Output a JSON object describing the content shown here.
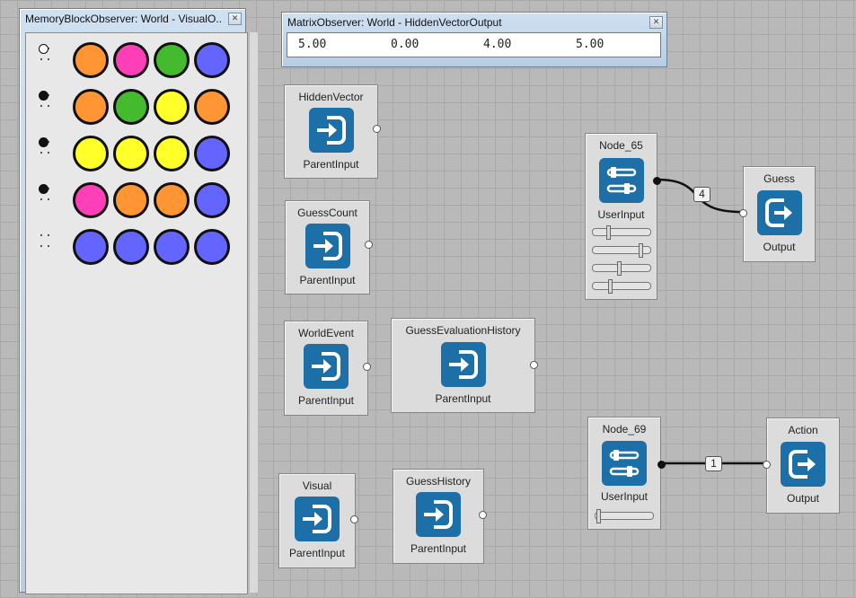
{
  "memory_observer": {
    "title": "MemoryBlockObserver: World - VisualO...",
    "rows": [
      {
        "indicator": "open",
        "pegs": [
          "#ff9633",
          "#ff3fb8",
          "#44bb2e",
          "#6464ff"
        ]
      },
      {
        "indicator": "filled",
        "pegs": [
          "#ff9633",
          "#44bb2e",
          "#ffff2a",
          "#ff9633"
        ]
      },
      {
        "indicator": "filled",
        "pegs": [
          "#ffff2a",
          "#ffff2a",
          "#ffff2a",
          "#6464ff"
        ]
      },
      {
        "indicator": "filled",
        "pegs": [
          "#ff3fb8",
          "#ff9633",
          "#ff9633",
          "#6464ff"
        ]
      },
      {
        "indicator": "none",
        "pegs": [
          "#6464ff",
          "#6464ff",
          "#6464ff",
          "#6464ff"
        ]
      }
    ]
  },
  "matrix_observer": {
    "title": "MatrixObserver: World - HiddenVectorOutput",
    "values": [
      "5.00",
      "0.00",
      "4.00",
      "5.00"
    ]
  },
  "nodes": {
    "hidden_vector": {
      "name": "HiddenVector",
      "type": "ParentInput"
    },
    "guess_count": {
      "name": "GuessCount",
      "type": "ParentInput"
    },
    "world_event": {
      "name": "WorldEvent",
      "type": "ParentInput"
    },
    "guess_eval": {
      "name": "GuessEvaluationHistory",
      "type": "ParentInput"
    },
    "visual": {
      "name": "Visual",
      "type": "ParentInput"
    },
    "guess_history": {
      "name": "GuessHistory",
      "type": "ParentInput"
    },
    "node_65": {
      "name": "Node_65",
      "type": "UserInput",
      "slider_levels": [
        0.25,
        0.85,
        0.45,
        0.28
      ]
    },
    "node_69": {
      "name": "Node_69",
      "type": "UserInput",
      "slider_levels": [
        0.02
      ]
    },
    "guess": {
      "name": "Guess",
      "type": "Output"
    },
    "action": {
      "name": "Action",
      "type": "Output"
    }
  },
  "edges": {
    "node65_to_guess": {
      "label": "4"
    },
    "node69_to_action": {
      "label": "1"
    }
  },
  "colors": {
    "icon_blue": "#1d6fa8",
    "orange": "#ff9633",
    "pink": "#ff3fb8",
    "green": "#44bb2e",
    "yellow": "#ffff2a",
    "blue": "#6464ff"
  },
  "icons": {
    "parent_input": "enter-arrow-icon",
    "user_input": "sliders-icon",
    "output": "exit-arrow-icon"
  }
}
